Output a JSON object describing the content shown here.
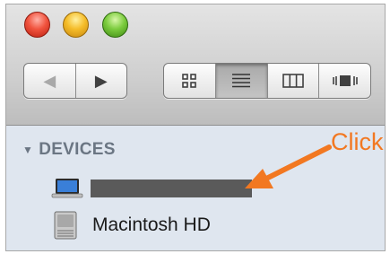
{
  "window": {
    "traffic_lights": [
      "close",
      "minimize",
      "zoom"
    ]
  },
  "toolbar": {
    "nav": {
      "back_icon": "◀",
      "forward_icon": "▶"
    },
    "view_modes": [
      "icon",
      "list",
      "column",
      "cover-flow"
    ],
    "active_view": "list"
  },
  "sidebar": {
    "section_title": "DEVICES",
    "disclosure": "▼",
    "devices": [
      {
        "icon": "laptop-icon",
        "label": ""
      },
      {
        "icon": "hard-drive-icon",
        "label": "Macintosh HD"
      }
    ]
  },
  "annotation": {
    "text": "Click",
    "color": "#f27821"
  }
}
